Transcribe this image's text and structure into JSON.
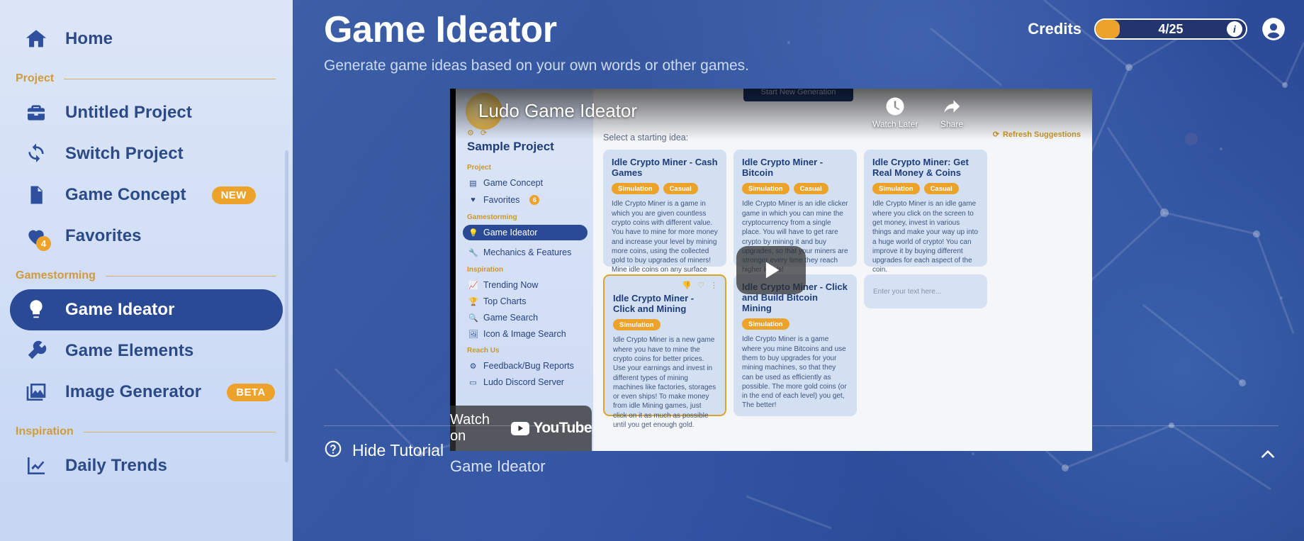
{
  "sidebar": {
    "home": {
      "label": "Home",
      "icon": "home-icon"
    },
    "sections": [
      {
        "label": "Project"
      },
      {
        "label": "Gamestorming"
      },
      {
        "label": "Inspiration"
      }
    ],
    "items": [
      {
        "label": "Untitled Project",
        "icon": "toolbox-icon",
        "badge": ""
      },
      {
        "label": "Switch Project",
        "icon": "switch-icon",
        "badge": ""
      },
      {
        "label": "Game Concept",
        "icon": "document-icon",
        "badge": "NEW"
      },
      {
        "label": "Favorites",
        "icon": "heart-icon",
        "count": "4"
      },
      {
        "label": "Game Ideator",
        "icon": "lightbulb-icon",
        "active": true
      },
      {
        "label": "Game Elements",
        "icon": "wrench-icon"
      },
      {
        "label": "Image Generator",
        "icon": "image-icon",
        "badge": "BETA"
      },
      {
        "label": "Daily Trends",
        "icon": "trend-chart-icon"
      }
    ]
  },
  "header": {
    "title": "Game Ideator",
    "subtitle": "Generate game ideas based on your own words or other games.",
    "credits_label": "Credits",
    "credits_value": "4/25",
    "credits_info_icon": "info-icon",
    "avatar_icon": "user-avatar-icon"
  },
  "video": {
    "yt_title": "Ludo Game Ideator",
    "watch_later": "Watch Later",
    "share": "Share",
    "watch_on": "Watch on",
    "youtube_brand": "YouTube",
    "caption": "Game Ideator",
    "play_icon": "play-icon",
    "inner_app": {
      "project_name": "Sample Project",
      "new_generation_button": "Start New Generation",
      "select_prompt": "Select a starting idea:",
      "refresh_label": "Refresh Suggestions",
      "text_input_placeholder": "Enter your text here...",
      "sections": [
        {
          "label": "Project"
        },
        {
          "label": "Gamestorming"
        },
        {
          "label": "Inspiration"
        },
        {
          "label": "Reach Us"
        }
      ],
      "nav": [
        {
          "label": "Game Concept",
          "icon": "document-icon"
        },
        {
          "label": "Favorites",
          "icon": "heart-icon",
          "count": "6"
        },
        {
          "label": "Game Ideator",
          "icon": "lightbulb-icon",
          "active": true
        },
        {
          "label": "Mechanics & Features",
          "icon": "wrench-icon"
        },
        {
          "label": "Trending Now",
          "icon": "trend-chart-icon"
        },
        {
          "label": "Top Charts",
          "icon": "trophy-icon"
        },
        {
          "label": "Game Search",
          "icon": "search-icon"
        },
        {
          "label": "Icon & Image Search",
          "icon": "image-search-icon"
        },
        {
          "label": "Feedback/Bug Reports",
          "icon": "gear-icon"
        },
        {
          "label": "Ludo Discord Server",
          "icon": "discord-icon"
        }
      ],
      "cards": [
        {
          "title": "Idle Crypto Miner - Cash Games",
          "tags": [
            "Simulation",
            "Casual"
          ],
          "body": "Idle Crypto Miner is a game in which you are given countless crypto coins with different value. You have to mine for more money and increase your level by mining more coins, using the collected gold to buy upgrades of miners! Mine idle coins on any surface"
        },
        {
          "title": "Idle Crypto Miner - Bitcoin",
          "tags": [
            "Simulation",
            "Casual"
          ],
          "body": "Idle Crypto Miner is an idle clicker game in which you can mine the cryptocurrency from a single place. You will have to get rare crypto by mining it and buy upgrades, so that your miners are stronger every time they reach higher levels!"
        },
        {
          "title": "Idle Crypto Miner: Get Real Money & Coins",
          "tags": [
            "Simulation",
            "Casual"
          ],
          "body": "Idle Crypto Miner is an idle game where you click on the screen to get money, invest in various things and make your way up into a huge world of crypto! You can improve it by buying different upgrades for each aspect of the coin."
        },
        {
          "title": "Idle Crypto Miner - Click and Mining",
          "tags": [
            "Simulation"
          ],
          "body": "Idle Crypto Miner is a new game where you have to mine the crypto coins for better prices. Use your earnings and invest in different types of mining machines like factories, storages or even ships! To make money from idle Mining games, just click on it as much as possible until you get enough gold.",
          "selected": true
        },
        {
          "title": "Idle Crypto Miner - Click and Build Bitcoin Mining",
          "tags": [
            "Simulation"
          ],
          "body": "Idle Crypto Miner is a game where you mine Bitcoins and use them to buy upgrades for your mining machines, so that they can be used as efficiently as possible. The more gold coins (or in the end of each level) you get, The better!"
        }
      ]
    }
  },
  "footer": {
    "hide_tutorial_label": "Hide Tutorial",
    "hide_tutorial_icon": "question-circle-icon",
    "collapse_icon": "chevron-up-icon"
  },
  "colors": {
    "accent_orange": "#eda22b",
    "brand_blue": "#2b4a96",
    "sidebar_text": "#2b4a86",
    "bg_blue": "#2e4f9e"
  }
}
